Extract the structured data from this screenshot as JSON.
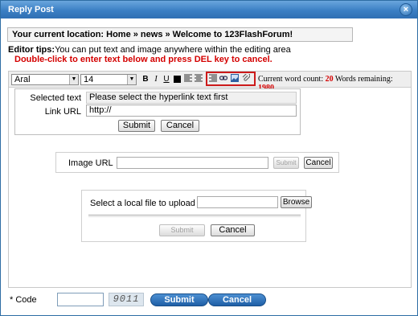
{
  "window": {
    "title": "Reply Post",
    "close_label": "×"
  },
  "location": {
    "text": "Your current location: Home » news » Welcome to 123FlashForum!"
  },
  "tips": {
    "label": "Editor tips:",
    "line1": "You can put text and image anywhere within the editing area",
    "line2": "Double-click to enter text below and press DEL key to cancel."
  },
  "toolbar": {
    "font": "Aral",
    "size": "14",
    "bold": "B",
    "italic": "I",
    "underline": "U",
    "word_count_label": "Current word count:",
    "word_count": "20",
    "words_remaining_label": "Words remaining:",
    "words_remaining": "1980"
  },
  "link_panel": {
    "selected_text_label": "Selected text",
    "selected_text_value": "Please select the hyperlink text first",
    "link_url_label": "Link URL",
    "link_url_value": "http://",
    "submit": "Submit",
    "cancel": "Cancel"
  },
  "image_panel": {
    "label": "Image URL",
    "submit": "Submit",
    "cancel": "Cancel"
  },
  "upload_panel": {
    "label": "Select a local file to upload",
    "browse": "Browse",
    "submit": "Submit",
    "cancel": "Cancel"
  },
  "footer": {
    "code_label": "* Code",
    "captcha": "9011",
    "submit": "Submit",
    "cancel": "Cancel"
  },
  "colors": {
    "title_bar": "#3b7fc4",
    "tip_red": "#d40000",
    "highlight_border": "#cc1a1a"
  }
}
